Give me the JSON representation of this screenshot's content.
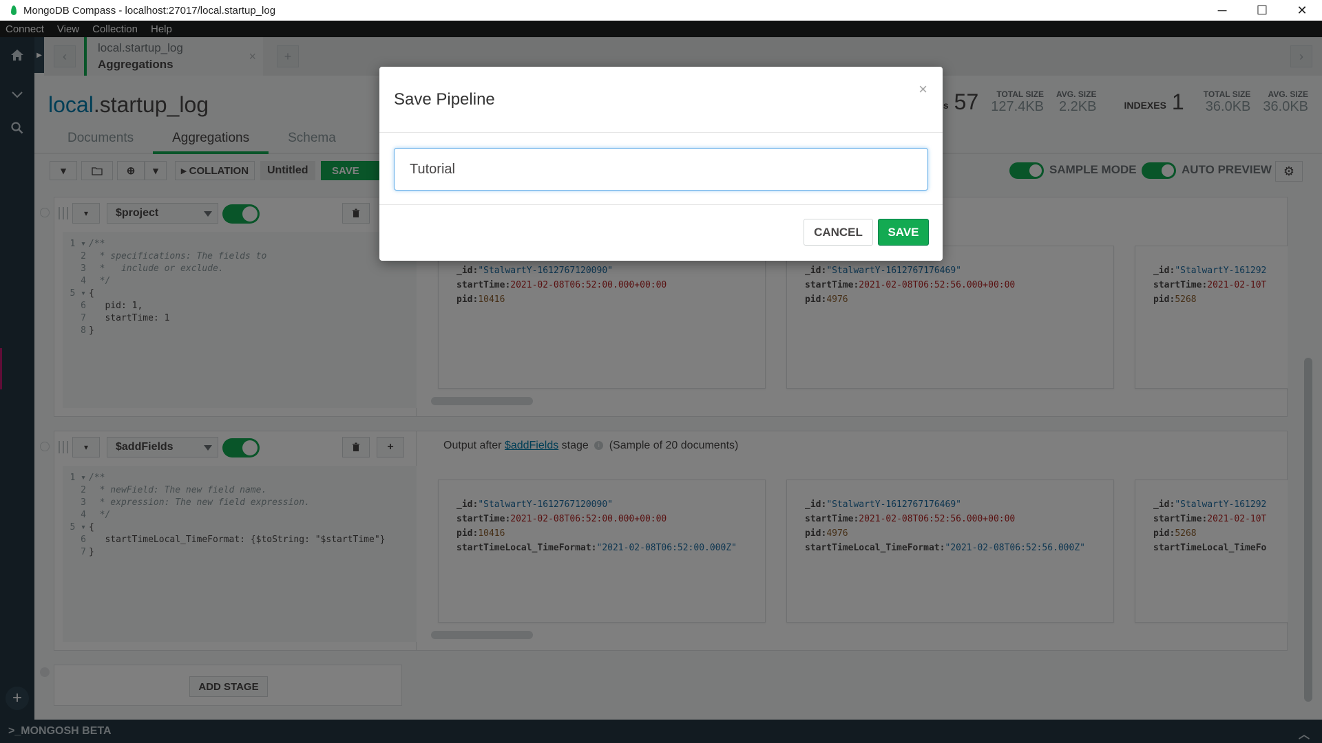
{
  "window": {
    "title": "MongoDB Compass - localhost:27017/local.startup_log",
    "minimize": "─",
    "maximize": "☐",
    "close": "✕"
  },
  "menu": [
    "Connect",
    "View",
    "Collection",
    "Help"
  ],
  "tab": {
    "line1": "local.startup_log",
    "line2": "Aggregations",
    "close": "×",
    "new_tab": "+",
    "back": "‹",
    "forward": "›"
  },
  "collection": {
    "db": "local",
    "name": ".startup_log",
    "tabs": [
      "Documents",
      "Aggregations",
      "Schema"
    ],
    "active_tab": "Aggregations"
  },
  "stats": {
    "documents_label": "s",
    "documents_count": "57",
    "doc_total_size_label": "TOTAL SIZE",
    "doc_total_size": "127.4KB",
    "doc_avg_size_label": "AVG. SIZE",
    "doc_avg_size": "2.2KB",
    "indexes_label": "INDEXES",
    "indexes_count": "1",
    "idx_total_size_label": "TOTAL SIZE",
    "idx_total_size": "36.0KB",
    "idx_avg_size_label": "AVG. SIZE",
    "idx_avg_size": "36.0KB"
  },
  "toolbar": {
    "collation_label": "▸ COLLATION",
    "pipeline_name": "Untitled",
    "save_label": "SAVE",
    "sample_mode_label": "SAMPLE MODE",
    "auto_preview_label": "AUTO PREVIEW"
  },
  "stages": [
    {
      "operator": "$project",
      "code": [
        {
          "n": "1 ▾",
          "t": "/**",
          "c": "cmt"
        },
        {
          "n": "2",
          "t": "  * specifications: The fields to",
          "c": "cmt"
        },
        {
          "n": "3",
          "t": "  *   include or exclude.",
          "c": "cmt"
        },
        {
          "n": "4",
          "t": "  */",
          "c": "cmt"
        },
        {
          "n": "5 ▾",
          "t": "{",
          "c": "code"
        },
        {
          "n": "6",
          "t": "   pid: 1,",
          "c": "code"
        },
        {
          "n": "7",
          "t": "   startTime: 1",
          "c": "code"
        },
        {
          "n": "8",
          "t": "}",
          "c": "code"
        }
      ],
      "docs": [
        {
          "id": "\"StalwartY-1612767120090\"",
          "startTime": "2021-02-08T06:52:00.000+00:00",
          "pid": "10416"
        },
        {
          "id": "\"StalwartY-1612767176469\"",
          "startTime": "2021-02-08T06:52:56.000+00:00",
          "pid": "4976"
        },
        {
          "id": "\"StalwartY-161292",
          "startTime": "2021-02-10T",
          "pid": "5268"
        }
      ]
    },
    {
      "operator": "$addFields",
      "output_prefix": "Output after ",
      "output_op": "$addFields",
      "output_suffix": " stage",
      "output_sample": " (Sample of 20 documents)",
      "code": [
        {
          "n": "1 ▾",
          "t": "/**",
          "c": "cmt"
        },
        {
          "n": "2",
          "t": "  * newField: The new field name.",
          "c": "cmt"
        },
        {
          "n": "3",
          "t": "  * expression: The new field expression.",
          "c": "cmt"
        },
        {
          "n": "4",
          "t": "  */",
          "c": "cmt"
        },
        {
          "n": "5 ▾",
          "t": "{",
          "c": "code"
        },
        {
          "n": "6",
          "t": "   startTimeLocal_TimeFormat: {$toString: \"$startTime\"}",
          "c": "code"
        },
        {
          "n": "7",
          "t": "}",
          "c": "code"
        }
      ],
      "docs": [
        {
          "id": "\"StalwartY-1612767120090\"",
          "startTime": "2021-02-08T06:52:00.000+00:00",
          "pid": "10416",
          "fmt": "\"2021-02-08T06:52:00.000Z\""
        },
        {
          "id": "\"StalwartY-1612767176469\"",
          "startTime": "2021-02-08T06:52:56.000+00:00",
          "pid": "4976",
          "fmt": "\"2021-02-08T06:52:56.000Z\""
        },
        {
          "id": "\"StalwartY-161292",
          "startTime": "2021-02-10T",
          "pid": "5268",
          "fmt": ""
        }
      ]
    }
  ],
  "doc_keys": {
    "id": "_id:",
    "startTime": "startTime:",
    "pid": "pid:",
    "fmt": "startTimeLocal_TimeFormat:",
    "fmt_truncated": "startTimeLocal_TimeFo"
  },
  "add_stage_label": "ADD STAGE",
  "mongosh_label": ">_MONGOSH BETA",
  "modal": {
    "title": "Save Pipeline",
    "input_value": "Tutorial",
    "cancel_label": "CANCEL",
    "save_label": "SAVE",
    "close": "×"
  },
  "colors": {
    "accent_green": "#13aa52",
    "sidebar": "#243642",
    "link_blue": "#007cad"
  }
}
